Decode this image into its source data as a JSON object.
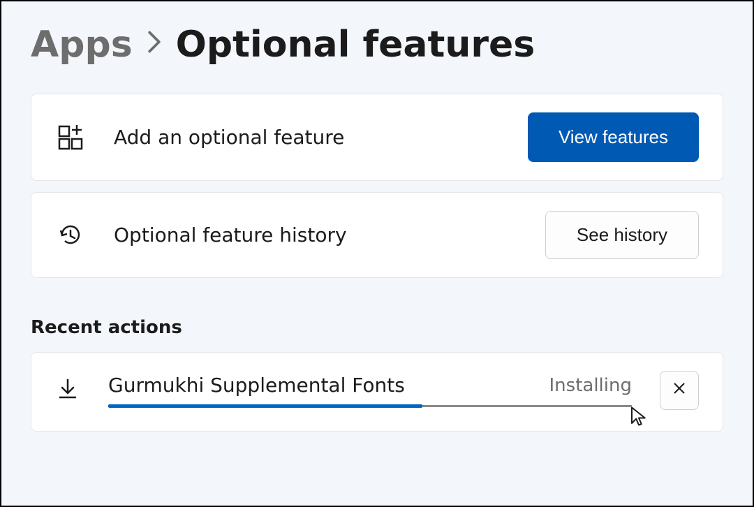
{
  "breadcrumb": {
    "parent": "Apps",
    "current": "Optional features"
  },
  "add_feature": {
    "label": "Add an optional feature",
    "button": "View features"
  },
  "history": {
    "label": "Optional feature history",
    "button": "See history"
  },
  "recent_heading": "Recent actions",
  "recent_action": {
    "title": "Gurmukhi Supplemental Fonts",
    "status": "Installing",
    "progress_percent": 60
  },
  "colors": {
    "accent": "#0067c0",
    "primary_button": "#0059b3",
    "page_bg": "#f3f6fb"
  }
}
